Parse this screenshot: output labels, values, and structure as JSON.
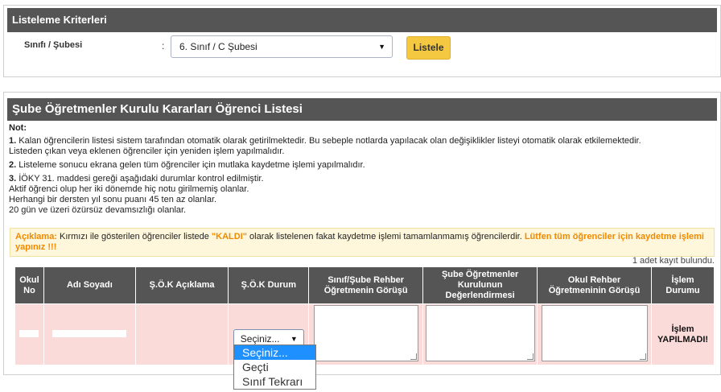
{
  "criteria": {
    "header": "Listeleme Kriterleri",
    "class_label": "Sınıfı / Şubesi",
    "colon": ":",
    "class_value": "6. Sınıf / C Şubesi",
    "list_button": "Listele"
  },
  "list": {
    "header": "Şube Öğretmenler Kurulu Kararları Öğrenci Listesi",
    "note_label": "Not:",
    "notes": [
      {
        "num": "1.",
        "text": " Kalan öğrencilerin listesi sistem tarafından otomatik olarak getirilmektedir. Bu sebeple notlarda yapılacak olan değişiklikler listeyi otomatik olarak etkilemektedir.",
        "line2": "Listeden çıkan veya eklenen öğrenciler için yeniden işlem yapılmalıdır."
      },
      {
        "num": "2.",
        "text": " Listeleme sonucu ekrana gelen tüm öğrenciler için mutlaka kaydetme işlemi yapılmalıdır."
      },
      {
        "num": "3.",
        "text": " İÖKY 31. maddesi gereği aşağıdaki durumlar kontrol edilmiştir.",
        "line2": "Aktif öğrenci olup her iki dönemde hiç notu girilmemiş olanlar.",
        "line3": "Herhangi bir dersten yıl sonu puanı 45 ten az olanlar.",
        "line4": "20 gün ve üzeri özürsüz devamsızlığı olanlar."
      }
    ],
    "info": {
      "label": "Açıklama:",
      "text1": " Kırmızı ile gösterilen öğrenciler listede ",
      "kaldi": "\"KALDI\"",
      "text2": " olarak listelenen fakat kaydetme işlemi tamamlanmamış öğrencilerdir. ",
      "warning": "Lütfen tüm öğrenciler için kaydetme işlemi yapınız !!!"
    },
    "record_count": "1 adet kayıt bulundu.",
    "columns": {
      "no_1": "Okul",
      "no_2": "No",
      "name": "Adı Soyadı",
      "sok_desc": "Ş.Ö.K Açıklama",
      "sok_status": "Ş.Ö.K Durum",
      "teacher_1": "Sınıf/Şube Rehber",
      "teacher_2": "Öğretmenin Görüşü",
      "board_1": "Şube Öğretmenler",
      "board_2": "Kurulunun",
      "board_3": "Değerlendirmesi",
      "school_1": "Okul Rehber",
      "school_2": "Öğretmeninin Görüşü",
      "status_1": "İşlem",
      "status_2": "Durumu"
    },
    "row": {
      "status_select_value": "Seçiniz...",
      "status_1": "İşlem",
      "status_2": "YAPILMADI!"
    },
    "dropdown_options": [
      "Seçiniz...",
      "Geçti",
      "Sınıf Tekrarı"
    ]
  }
}
